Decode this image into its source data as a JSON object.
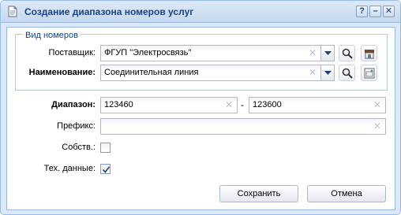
{
  "window": {
    "title": "Создание диапазона номеров услуг",
    "tools": [
      "?",
      "–",
      "✕"
    ]
  },
  "group": {
    "legend": "Вид номеров",
    "supplier_label": "Поставщик:",
    "supplier_value": "ФГУП \"Электросвязь\"",
    "name_label": "Наименование:",
    "name_value": "Соединительная линия"
  },
  "range": {
    "label": "Диапазон:",
    "from": "123460",
    "separator": "-",
    "to": "123600"
  },
  "prefix": {
    "label": "Префикс:",
    "value": ""
  },
  "own": {
    "label": "Собств.:",
    "checked": false
  },
  "tech": {
    "label": "Тех. данные:",
    "checked": true
  },
  "buttons": {
    "save": "Сохранить",
    "cancel": "Отмена"
  }
}
